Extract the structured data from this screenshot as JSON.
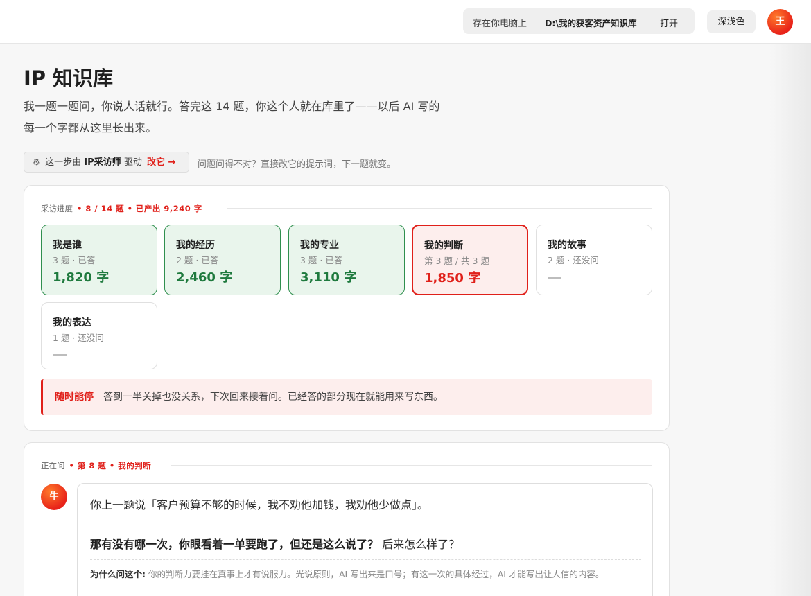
{
  "topbar": {
    "store_label": "存在你电脑上",
    "store_path": "D:\\我的获客资产知识库",
    "open_label": "打开",
    "theme_label": "深浅色",
    "avatar_text": "王"
  },
  "page": {
    "title": "IP 知识库",
    "intro": "我一题一题问，你说人话就行。答完这 14 题，你这个人就在库里了——以后 AI 写的每一个字都从这里长出来。"
  },
  "driver": {
    "prefix": "这一步由",
    "agent": "IP采访师",
    "suffix": "驱动",
    "edit_label": "改它 →",
    "note": "问题问得不对？直接改它的提示词，下一题就变。"
  },
  "progress": {
    "label": "采访进度",
    "summary": "• 8 / 14 题 • 已产出 9,240 字",
    "tiles": [
      {
        "title": "我是谁",
        "sub": "3 题 · 已答",
        "count": "1,820 字",
        "state": "done"
      },
      {
        "title": "我的经历",
        "sub": "2 题 · 已答",
        "count": "2,460 字",
        "state": "done"
      },
      {
        "title": "我的专业",
        "sub": "3 题 · 已答",
        "count": "3,110 字",
        "state": "done"
      },
      {
        "title": "我的判断",
        "sub": "第 3 题 / 共 3 题",
        "count": "1,850 字",
        "state": "active"
      },
      {
        "title": "我的故事",
        "sub": "2 题 · 还没问",
        "count": "",
        "state": "pending"
      },
      {
        "title": "我的表达",
        "sub": "1 题 · 还没问",
        "count": "",
        "state": "pending"
      }
    ],
    "notice_title": "随时能停",
    "notice_text": "答到一半关掉也没关系，下次回来接着问。已经答的部分现在就能用来写东西。"
  },
  "current": {
    "label": "正在问",
    "summary": "• 第 8 题 • 我的判断",
    "bot_avatar": "牛",
    "line1": "你上一题说「客户预算不够的时候，我不劝他加钱，我劝他少做点」。",
    "question_bold": "那有没有哪一次，你眼看着一单要跑了，但还是这么说了？",
    "question_tail": "后来怎么样了？",
    "why_label": "为什么问这个:",
    "why_text": "你的判断力要挂在真事上才有说服力。光说原则，AI 写出来是口号；有这一次的具体经过，AI 才能写出让人信的内容。"
  },
  "colors": {
    "accent": "#e0201a",
    "done_green": "#1f7a3e",
    "done_bg": "#e9f5ec",
    "active_bg": "#fdeeed"
  }
}
